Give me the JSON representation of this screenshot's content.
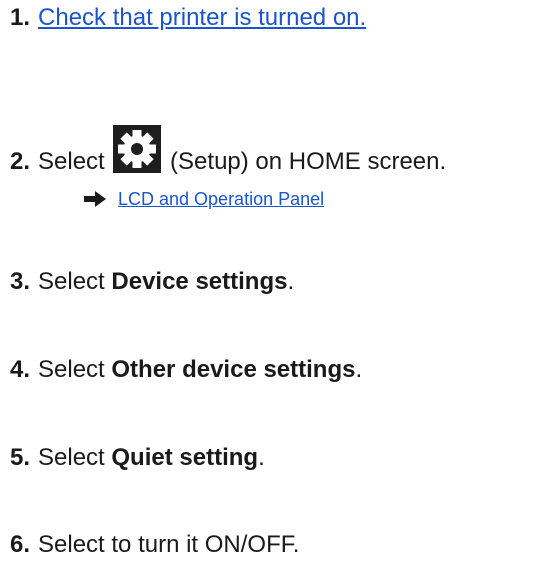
{
  "steps": [
    {
      "num": "1.",
      "link_text": "Check that printer is turned on."
    },
    {
      "num": "2.",
      "prefix": "Select ",
      "suffix": " (Setup) on HOME screen."
    },
    {
      "num": "3.",
      "prefix": "Select ",
      "bold": "Device settings",
      "suffix": "."
    },
    {
      "num": "4.",
      "prefix": "Select ",
      "bold": "Other device settings",
      "suffix": "."
    },
    {
      "num": "5.",
      "prefix": "Select ",
      "bold": "Quiet setting",
      "suffix": "."
    },
    {
      "num": "6.",
      "text": "Select to turn it ON/OFF."
    }
  ],
  "sub_link": {
    "icon": "arrow-right-icon",
    "text": "LCD and Operation Panel"
  },
  "setup_icon": "gear-icon",
  "colors": {
    "link": "#1a55cc",
    "text": "#1a1a1a",
    "icon_bg": "#1e1e1e"
  }
}
